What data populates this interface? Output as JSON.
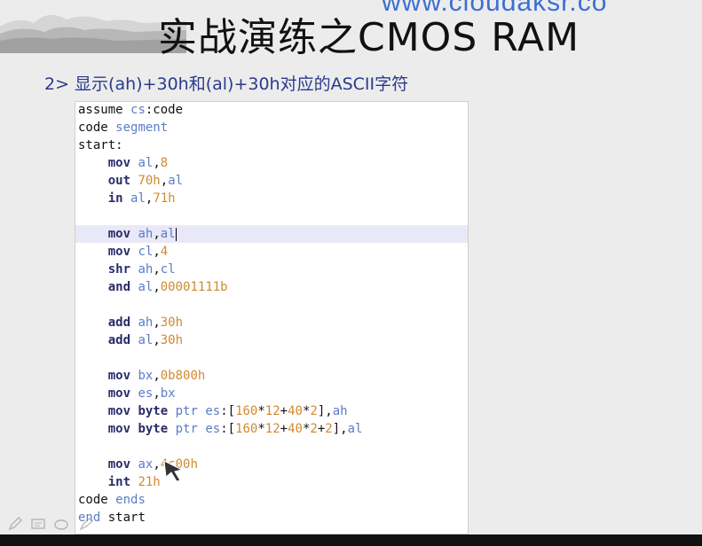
{
  "slide": {
    "url_text": "www.cloudaksr.co",
    "title": "实战演练之CMOS RAM",
    "subtitle": "2> 显示(ah)+30h和(al)+30h对应的ASCII字符"
  },
  "code": {
    "lines": [
      [
        [
          "plain",
          "assume "
        ],
        [
          "kw2",
          "cs"
        ],
        [
          "plain",
          ":code"
        ]
      ],
      [
        [
          "plain",
          "code "
        ],
        [
          "kw2",
          "segment"
        ]
      ],
      [
        [
          "plain",
          "start:"
        ]
      ],
      [
        [
          "plain",
          "    "
        ],
        [
          "kw",
          "mov"
        ],
        [
          "plain",
          " "
        ],
        [
          "kw2",
          "al"
        ],
        [
          "plain",
          ","
        ],
        [
          "num",
          "8"
        ]
      ],
      [
        [
          "plain",
          "    "
        ],
        [
          "kw",
          "out"
        ],
        [
          "plain",
          " "
        ],
        [
          "num",
          "70h"
        ],
        [
          "plain",
          ","
        ],
        [
          "kw2",
          "al"
        ]
      ],
      [
        [
          "plain",
          "    "
        ],
        [
          "kw",
          "in"
        ],
        [
          "plain",
          " "
        ],
        [
          "kw2",
          "al"
        ],
        [
          "plain",
          ","
        ],
        [
          "num",
          "71h"
        ]
      ],
      [],
      [
        [
          "plain",
          "    "
        ],
        [
          "kw",
          "mov"
        ],
        [
          "plain",
          " "
        ],
        [
          "kw2",
          "ah"
        ],
        [
          "plain",
          ","
        ],
        [
          "kw2",
          "al"
        ]
      ],
      [
        [
          "plain",
          "    "
        ],
        [
          "kw",
          "mov"
        ],
        [
          "plain",
          " "
        ],
        [
          "kw2",
          "cl"
        ],
        [
          "plain",
          ","
        ],
        [
          "num",
          "4"
        ]
      ],
      [
        [
          "plain",
          "    "
        ],
        [
          "kw",
          "shr"
        ],
        [
          "plain",
          " "
        ],
        [
          "kw2",
          "ah"
        ],
        [
          "plain",
          ","
        ],
        [
          "kw2",
          "cl"
        ]
      ],
      [
        [
          "plain",
          "    "
        ],
        [
          "kw",
          "and"
        ],
        [
          "plain",
          " "
        ],
        [
          "kw2",
          "al"
        ],
        [
          "plain",
          ","
        ],
        [
          "num",
          "00001111b"
        ]
      ],
      [],
      [
        [
          "plain",
          "    "
        ],
        [
          "kw",
          "add"
        ],
        [
          "plain",
          " "
        ],
        [
          "kw2",
          "ah"
        ],
        [
          "plain",
          ","
        ],
        [
          "num",
          "30h"
        ]
      ],
      [
        [
          "plain",
          "    "
        ],
        [
          "kw",
          "add"
        ],
        [
          "plain",
          " "
        ],
        [
          "kw2",
          "al"
        ],
        [
          "plain",
          ","
        ],
        [
          "num",
          "30h"
        ]
      ],
      [],
      [
        [
          "plain",
          "    "
        ],
        [
          "kw",
          "mov"
        ],
        [
          "plain",
          " "
        ],
        [
          "kw2",
          "bx"
        ],
        [
          "plain",
          ","
        ],
        [
          "num",
          "0b800h"
        ]
      ],
      [
        [
          "plain",
          "    "
        ],
        [
          "kw",
          "mov"
        ],
        [
          "plain",
          " "
        ],
        [
          "kw2",
          "es"
        ],
        [
          "plain",
          ","
        ],
        [
          "kw2",
          "bx"
        ]
      ],
      [
        [
          "plain",
          "    "
        ],
        [
          "kw",
          "mov"
        ],
        [
          "plain",
          " "
        ],
        [
          "kw",
          "byte"
        ],
        [
          "plain",
          " "
        ],
        [
          "kw2",
          "ptr"
        ],
        [
          "plain",
          " "
        ],
        [
          "kw2",
          "es"
        ],
        [
          "plain",
          ":["
        ],
        [
          "num",
          "160"
        ],
        [
          "plain",
          "*"
        ],
        [
          "num",
          "12"
        ],
        [
          "plain",
          "+"
        ],
        [
          "num",
          "40"
        ],
        [
          "plain",
          "*"
        ],
        [
          "num",
          "2"
        ],
        [
          "plain",
          "],"
        ],
        [
          "kw2",
          "ah"
        ]
      ],
      [
        [
          "plain",
          "    "
        ],
        [
          "kw",
          "mov"
        ],
        [
          "plain",
          " "
        ],
        [
          "kw",
          "byte"
        ],
        [
          "plain",
          " "
        ],
        [
          "kw2",
          "ptr"
        ],
        [
          "plain",
          " "
        ],
        [
          "kw2",
          "es"
        ],
        [
          "plain",
          ":["
        ],
        [
          "num",
          "160"
        ],
        [
          "plain",
          "*"
        ],
        [
          "num",
          "12"
        ],
        [
          "plain",
          "+"
        ],
        [
          "num",
          "40"
        ],
        [
          "plain",
          "*"
        ],
        [
          "num",
          "2"
        ],
        [
          "plain",
          "+"
        ],
        [
          "num",
          "2"
        ],
        [
          "plain",
          "],"
        ],
        [
          "kw2",
          "al"
        ]
      ],
      [],
      [
        [
          "plain",
          "    "
        ],
        [
          "kw",
          "mov"
        ],
        [
          "plain",
          " "
        ],
        [
          "kw2",
          "ax"
        ],
        [
          "plain",
          ","
        ],
        [
          "num",
          "4c00h"
        ]
      ],
      [
        [
          "plain",
          "    "
        ],
        [
          "kw",
          "int"
        ],
        [
          "plain",
          " "
        ],
        [
          "num",
          "21h"
        ]
      ],
      [
        [
          "plain",
          "code "
        ],
        [
          "kw2",
          "ends"
        ]
      ],
      [
        [
          "kw2",
          "end"
        ],
        [
          "plain",
          " start"
        ]
      ]
    ],
    "highlighted_line": 7
  },
  "toolbar": {
    "icons": [
      "pen-icon",
      "slide-icon",
      "eraser-icon",
      "highlighter-icon"
    ]
  }
}
